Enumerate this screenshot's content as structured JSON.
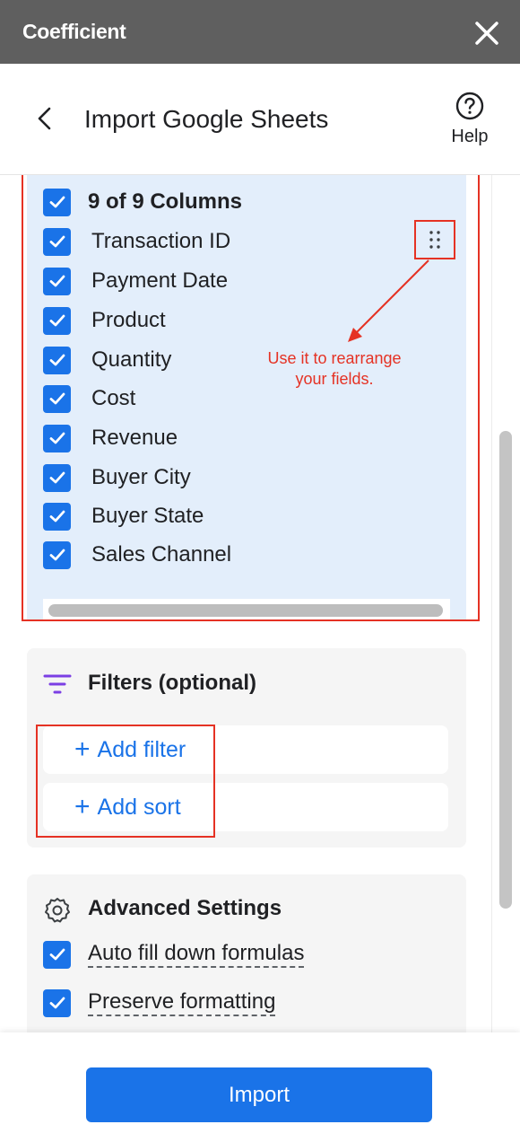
{
  "app": {
    "title": "Coefficient"
  },
  "header": {
    "title": "Import Google Sheets",
    "help_label": "Help"
  },
  "columns": {
    "summary": "9 of 9 Columns",
    "items": [
      {
        "label": "Transaction ID",
        "checked": true
      },
      {
        "label": "Payment Date",
        "checked": true
      },
      {
        "label": "Product",
        "checked": true
      },
      {
        "label": "Quantity",
        "checked": true
      },
      {
        "label": "Cost",
        "checked": true
      },
      {
        "label": "Revenue",
        "checked": true
      },
      {
        "label": "Buyer City",
        "checked": true
      },
      {
        "label": "Buyer State",
        "checked": true
      },
      {
        "label": "Sales Channel",
        "checked": true
      }
    ]
  },
  "annotation": {
    "line1": "Use it to rearrange",
    "line2": "your fields."
  },
  "filters": {
    "title": "Filters (optional)",
    "add_filter": "Add filter",
    "add_sort": "Add sort"
  },
  "advanced": {
    "title": "Advanced Settings",
    "options": [
      {
        "label": "Auto fill down formulas",
        "checked": true
      },
      {
        "label": "Preserve formatting",
        "checked": true
      }
    ]
  },
  "footer": {
    "import_label": "Import"
  },
  "colors": {
    "topbar": "#5f5f5f",
    "accent": "#1a73e8",
    "annotation": "#e53224",
    "panel": "#e3eefb",
    "card": "#f5f5f5",
    "filter_icon": "#7b3fe4"
  },
  "icons": {
    "close": "close-icon",
    "back": "chevron-left-icon",
    "help": "question-circle-icon",
    "drag": "drag-handle-icon",
    "filter": "filter-icon",
    "settings": "gear-icon",
    "check": "checkmark-icon",
    "plus": "plus-icon"
  }
}
